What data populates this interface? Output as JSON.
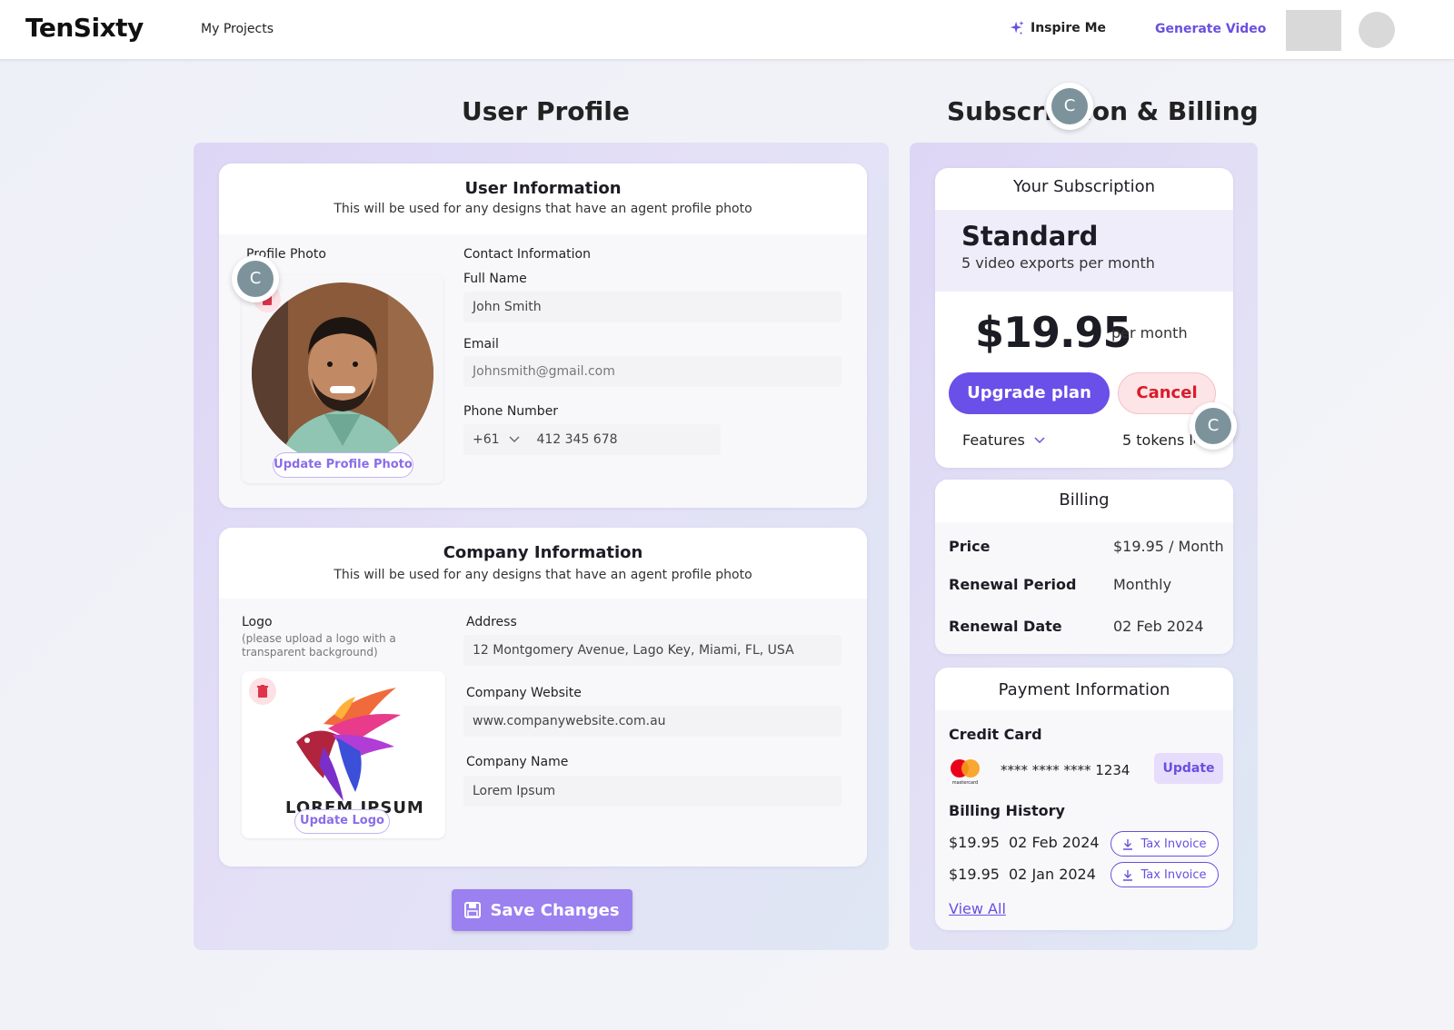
{
  "nav": {
    "brand": "TenSixty",
    "my_projects": "My Projects",
    "inspire_me": "Inspire Me",
    "generate_video": "Generate Video"
  },
  "colors": {
    "accent": "#6a4fe0",
    "accent_light": "#9b80f0",
    "danger": "#d91b2a",
    "panel_tint": "#e4e0f6"
  },
  "icons": {
    "inspire": "sparkle-icon",
    "trash": "trash-icon",
    "save": "floppy-disk-icon",
    "chevron": "chevron-down-icon",
    "download": "download-icon",
    "card_brand": "mastercard-logo"
  },
  "user_profile": {
    "title": "User Profile",
    "user_info": {
      "title": "User Information",
      "subtitle": "This will be used for any designs that have an agent profile photo",
      "profile_photo_label": "Profile Photo",
      "update_photo": "Update Profile Photo",
      "contact_label": "Contact Information",
      "full_name_label": "Full Name",
      "full_name": "John Smith",
      "email_label": "Email",
      "email_placeholder": "Johnsmith@gmail.com",
      "phone_label": "Phone Number",
      "phone_code": "+61",
      "phone_number": "412 345 678"
    },
    "company_info": {
      "title": "Company Information",
      "subtitle": "This will be used for any designs that have an agent profile photo",
      "logo_label": "Logo",
      "logo_note": "(please upload a logo with a transparent background)",
      "logo_text": "LOREM IPSUM",
      "update_logo": "Update Logo",
      "address_label": "Address",
      "address": "12 Montgomery Avenue, Lago Key, Miami, FL, USA",
      "website_label": "Company Website",
      "website": "www.companywebsite.com.au",
      "name_label": "Company Name",
      "name": "Lorem Ipsum"
    },
    "save_changes": "Save Changes"
  },
  "collab_badge": "C",
  "subscription": {
    "title": "Subscription & Billing",
    "your_subscription": "Your Subscription",
    "plan": "Standard",
    "plan_desc": "5 video exports per month",
    "price": "$19.95",
    "per": "per month",
    "upgrade": "Upgrade plan",
    "cancel": "Cancel",
    "features": "Features",
    "tokens": "5 tokens left"
  },
  "billing": {
    "title": "Billing",
    "rows": [
      {
        "label": "Price",
        "value": "$19.95 / Month"
      },
      {
        "label": "Renewal Period",
        "value": "Monthly"
      },
      {
        "label": "Renewal Date",
        "value": "02 Feb 2024"
      }
    ]
  },
  "payment": {
    "title": "Payment Information",
    "credit_card_label": "Credit Card",
    "card_brand_text": "mastercard",
    "card_number": "**** **** **** 1234",
    "update": "Update",
    "history_label": "Billing History",
    "history": [
      {
        "amount": "$19.95",
        "date": "02 Feb 2024",
        "action": "Tax Invoice"
      },
      {
        "amount": "$19.95",
        "date": "02 Jan 2024",
        "action": "Tax Invoice"
      }
    ],
    "view_all": "View All"
  }
}
